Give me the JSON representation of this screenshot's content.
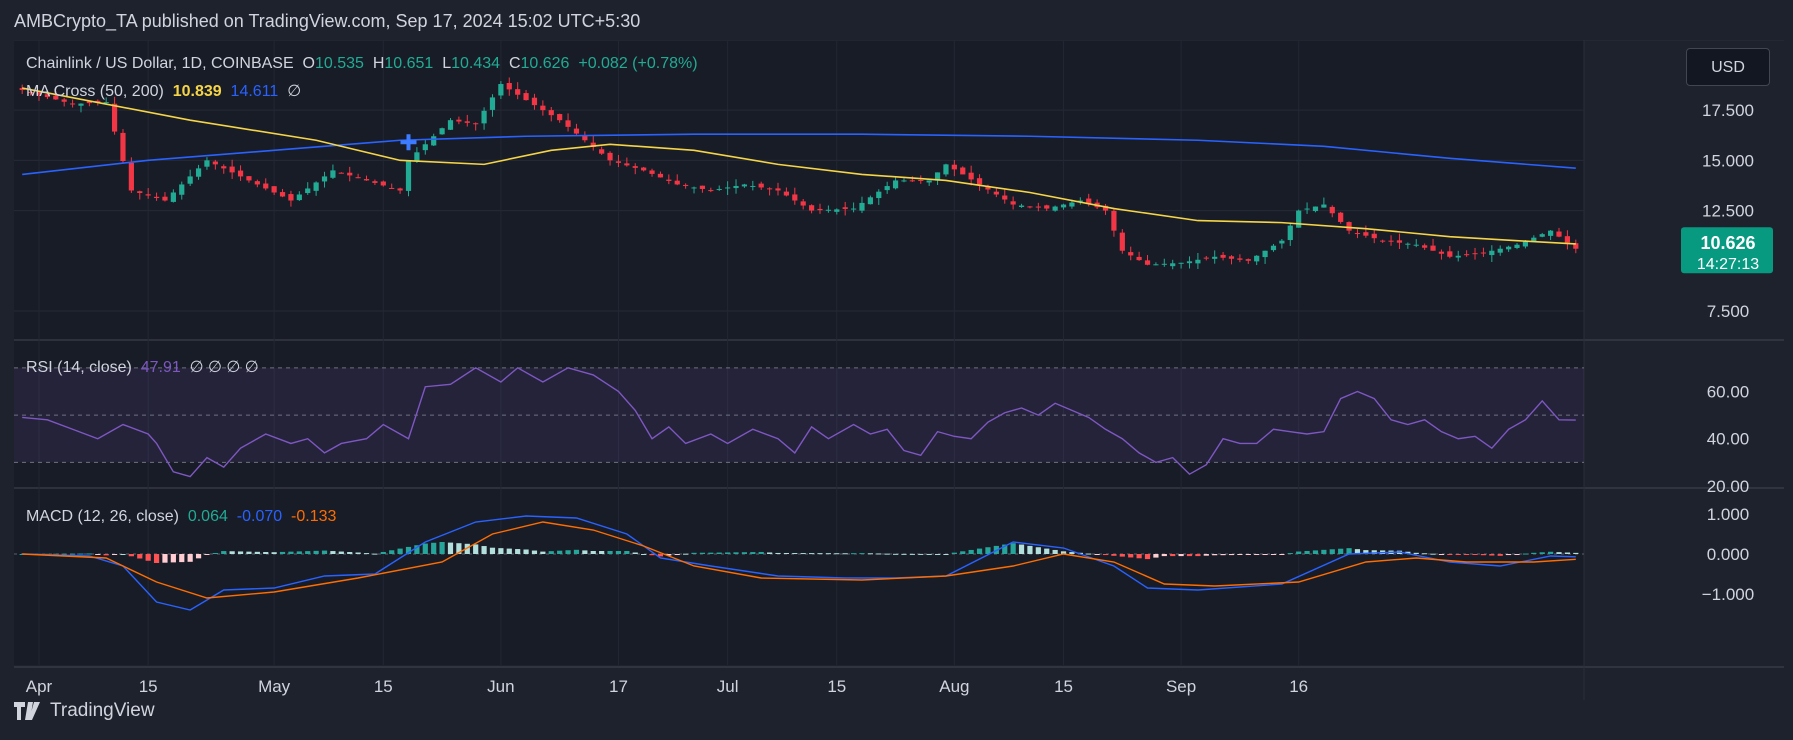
{
  "header": {
    "text": "AMBCrypto_TA published on TradingView.com, Sep 17, 2024 15:02 UTC+5:30"
  },
  "legend": {
    "symbol": "Chainlink / US Dollar, 1D, COINBASE",
    "o_label": "O",
    "o": "10.535",
    "h_label": "H",
    "h": "10.651",
    "l_label": "L",
    "l": "10.434",
    "c_label": "C",
    "c": "10.626",
    "change": "+0.082 (+0.78%)",
    "ma_label": "MA Cross (50, 200)",
    "ma50": "10.839",
    "ma200": "14.611",
    "ma_extra": "∅",
    "rsi_label": "RSI (14, close)",
    "rsi": "47.91",
    "rsi_extra": "∅ ∅ ∅ ∅",
    "macd_label": "MACD (12, 26, close)",
    "macd_hist": "0.064",
    "macd": "-0.070",
    "macd_signal": "-0.133"
  },
  "currency_button": "USD",
  "price_tag": {
    "price": "10.626",
    "countdown": "14:27:13"
  },
  "axes": {
    "price_ticks": [
      "17.500",
      "15.000",
      "12.500",
      "7.500"
    ],
    "rsi_ticks": [
      "60.00",
      "40.00",
      "20.00"
    ],
    "macd_ticks": [
      "1.000",
      "0.000",
      "−1.000"
    ],
    "x_ticks": [
      "Apr",
      "15",
      "May",
      "15",
      "Jun",
      "17",
      "Jul",
      "15",
      "Aug",
      "15",
      "Sep",
      "16"
    ]
  },
  "footer": {
    "brand": "TradingView"
  },
  "colors": {
    "up": "#22ab94",
    "down": "#f23645",
    "ma50": "#f5d547",
    "ma200": "#2962ff",
    "rsi": "#7e57c2",
    "macd": "#2962ff",
    "signal": "#ff6d00",
    "tag": "#089981"
  },
  "chart_data": {
    "type": "candlestick",
    "price_range": [
      7.5,
      19.0
    ],
    "close_anchors": [
      [
        0,
        18.5
      ],
      [
        6,
        17.8
      ],
      [
        10,
        17.9
      ],
      [
        13,
        13.5
      ],
      [
        17,
        13.0
      ],
      [
        22,
        15.0
      ],
      [
        27,
        14.0
      ],
      [
        32,
        13.0
      ],
      [
        37,
        14.5
      ],
      [
        41,
        14.0
      ],
      [
        45,
        13.5
      ],
      [
        46,
        15.0
      ],
      [
        51,
        17.0
      ],
      [
        54,
        16.8
      ],
      [
        57,
        18.8
      ],
      [
        60,
        18.0
      ],
      [
        64,
        17.0
      ],
      [
        67,
        16.0
      ],
      [
        70,
        15.0
      ],
      [
        74,
        14.5
      ],
      [
        78,
        13.8
      ],
      [
        82,
        13.5
      ],
      [
        86,
        13.8
      ],
      [
        90,
        13.5
      ],
      [
        94,
        12.5
      ],
      [
        99,
        12.6
      ],
      [
        104,
        14.0
      ],
      [
        108,
        14.0
      ],
      [
        110,
        14.8
      ],
      [
        114,
        13.8
      ],
      [
        118,
        12.8
      ],
      [
        122,
        12.6
      ],
      [
        126,
        13.0
      ],
      [
        129,
        12.5
      ],
      [
        131,
        10.5
      ],
      [
        134,
        9.8
      ],
      [
        138,
        9.9
      ],
      [
        142,
        10.2
      ],
      [
        146,
        10.0
      ],
      [
        150,
        11.0
      ],
      [
        152,
        12.5
      ],
      [
        155,
        12.8
      ],
      [
        158,
        11.5
      ],
      [
        162,
        11.0
      ],
      [
        166,
        10.8
      ],
      [
        170,
        10.2
      ],
      [
        174,
        10.4
      ],
      [
        178,
        10.8
      ],
      [
        182,
        11.5
      ],
      [
        185,
        10.6
      ]
    ],
    "ma50": [
      [
        0,
        18.6
      ],
      [
        20,
        17.0
      ],
      [
        35,
        16.0
      ],
      [
        45,
        15.0
      ],
      [
        55,
        14.8
      ],
      [
        63,
        15.5
      ],
      [
        70,
        15.8
      ],
      [
        80,
        15.5
      ],
      [
        90,
        14.8
      ],
      [
        100,
        14.3
      ],
      [
        110,
        14.0
      ],
      [
        120,
        13.4
      ],
      [
        130,
        12.6
      ],
      [
        140,
        12.0
      ],
      [
        150,
        11.9
      ],
      [
        160,
        11.6
      ],
      [
        170,
        11.2
      ],
      [
        178,
        11.0
      ],
      [
        185,
        10.84
      ]
    ],
    "ma200": [
      [
        0,
        14.3
      ],
      [
        15,
        15.0
      ],
      [
        30,
        15.5
      ],
      [
        45,
        16.0
      ],
      [
        60,
        16.2
      ],
      [
        80,
        16.3
      ],
      [
        100,
        16.3
      ],
      [
        120,
        16.2
      ],
      [
        140,
        16.0
      ],
      [
        155,
        15.7
      ],
      [
        170,
        15.1
      ],
      [
        185,
        14.61
      ]
    ],
    "ma_cross": {
      "x": 46,
      "y": 15.9
    },
    "rsi": [
      [
        0,
        49
      ],
      [
        3,
        48
      ],
      [
        6,
        44
      ],
      [
        9,
        40
      ],
      [
        12,
        46
      ],
      [
        15,
        42
      ],
      [
        16,
        38
      ],
      [
        18,
        26
      ],
      [
        20,
        24
      ],
      [
        22,
        32
      ],
      [
        24,
        28
      ],
      [
        26,
        36
      ],
      [
        29,
        42
      ],
      [
        32,
        38
      ],
      [
        34,
        40
      ],
      [
        36,
        34
      ],
      [
        38,
        38
      ],
      [
        41,
        40
      ],
      [
        43,
        46
      ],
      [
        45,
        42
      ],
      [
        46,
        40
      ],
      [
        48,
        62
      ],
      [
        51,
        63
      ],
      [
        54,
        70
      ],
      [
        57,
        64
      ],
      [
        59,
        70
      ],
      [
        62,
        64
      ],
      [
        65,
        70
      ],
      [
        68,
        67
      ],
      [
        71,
        60
      ],
      [
        73,
        52
      ],
      [
        75,
        40
      ],
      [
        77,
        45
      ],
      [
        79,
        38
      ],
      [
        82,
        42
      ],
      [
        84,
        38
      ],
      [
        87,
        44
      ],
      [
        90,
        40
      ],
      [
        92,
        34
      ],
      [
        94,
        45
      ],
      [
        96,
        40
      ],
      [
        99,
        46
      ],
      [
        101,
        42
      ],
      [
        103,
        44
      ],
      [
        105,
        35
      ],
      [
        107,
        33
      ],
      [
        109,
        43
      ],
      [
        111,
        41
      ],
      [
        113,
        40
      ],
      [
        115,
        47
      ],
      [
        117,
        51
      ],
      [
        119,
        53
      ],
      [
        121,
        50
      ],
      [
        123,
        55
      ],
      [
        125,
        52
      ],
      [
        127,
        49
      ],
      [
        129,
        44
      ],
      [
        131,
        40
      ],
      [
        133,
        34
      ],
      [
        135,
        30
      ],
      [
        137,
        32
      ],
      [
        139,
        25
      ],
      [
        141,
        29
      ],
      [
        143,
        40
      ],
      [
        145,
        38
      ],
      [
        147,
        38
      ],
      [
        149,
        44
      ],
      [
        151,
        43
      ],
      [
        153,
        42
      ],
      [
        155,
        43
      ],
      [
        157,
        57
      ],
      [
        159,
        60
      ],
      [
        161,
        57
      ],
      [
        163,
        48
      ],
      [
        165,
        46
      ],
      [
        167,
        48
      ],
      [
        169,
        43
      ],
      [
        171,
        40
      ],
      [
        173,
        41
      ],
      [
        175,
        36
      ],
      [
        177,
        44
      ],
      [
        179,
        48
      ],
      [
        181,
        56
      ],
      [
        183,
        48
      ],
      [
        185,
        47.91
      ]
    ],
    "macd_line": [
      [
        0,
        0.0
      ],
      [
        8,
        -0.05
      ],
      [
        12,
        -0.3
      ],
      [
        16,
        -1.2
      ],
      [
        20,
        -1.4
      ],
      [
        24,
        -0.9
      ],
      [
        30,
        -0.85
      ],
      [
        36,
        -0.55
      ],
      [
        42,
        -0.5
      ],
      [
        48,
        0.3
      ],
      [
        54,
        0.8
      ],
      [
        60,
        0.95
      ],
      [
        66,
        0.9
      ],
      [
        72,
        0.5
      ],
      [
        76,
        -0.1
      ],
      [
        82,
        -0.3
      ],
      [
        90,
        -0.55
      ],
      [
        98,
        -0.6
      ],
      [
        104,
        -0.6
      ],
      [
        110,
        -0.55
      ],
      [
        118,
        0.3
      ],
      [
        124,
        0.15
      ],
      [
        130,
        -0.3
      ],
      [
        134,
        -0.85
      ],
      [
        140,
        -0.9
      ],
      [
        150,
        -0.75
      ],
      [
        158,
        0.0
      ],
      [
        164,
        0.05
      ],
      [
        170,
        -0.2
      ],
      [
        176,
        -0.3
      ],
      [
        182,
        -0.05
      ],
      [
        185,
        -0.07
      ]
    ],
    "signal_line": [
      [
        0,
        0.0
      ],
      [
        10,
        -0.1
      ],
      [
        16,
        -0.7
      ],
      [
        22,
        -1.1
      ],
      [
        30,
        -0.95
      ],
      [
        40,
        -0.6
      ],
      [
        50,
        -0.2
      ],
      [
        56,
        0.5
      ],
      [
        62,
        0.8
      ],
      [
        68,
        0.6
      ],
      [
        74,
        0.2
      ],
      [
        80,
        -0.3
      ],
      [
        88,
        -0.6
      ],
      [
        100,
        -0.65
      ],
      [
        110,
        -0.55
      ],
      [
        118,
        -0.3
      ],
      [
        124,
        0.0
      ],
      [
        130,
        -0.2
      ],
      [
        136,
        -0.75
      ],
      [
        142,
        -0.8
      ],
      [
        152,
        -0.7
      ],
      [
        160,
        -0.2
      ],
      [
        166,
        -0.1
      ],
      [
        172,
        -0.2
      ],
      [
        180,
        -0.2
      ],
      [
        185,
        -0.133
      ]
    ],
    "rsi_band": [
      30,
      70
    ],
    "macd_range": [
      -1.6,
      1.1
    ],
    "rsi_range": [
      20,
      75
    ]
  }
}
